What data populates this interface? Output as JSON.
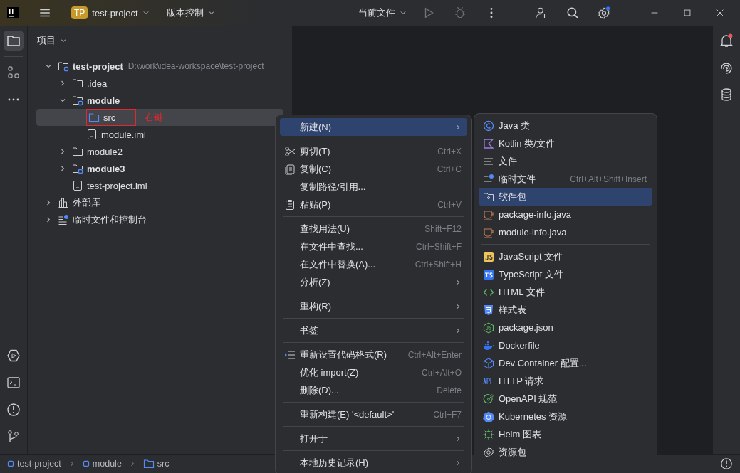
{
  "title_bar": {
    "project_badge": "TP",
    "project": "test-project",
    "vcs": "版本控制",
    "run_config": "当前文件"
  },
  "project_panel": {
    "title": "项目",
    "tree": [
      {
        "label": "test-project",
        "path": "D:\\work\\idea-workspace\\test-project",
        "kind": "module",
        "bold": true,
        "expanded": true,
        "selected": false,
        "children": [
          {
            "label": ".idea",
            "kind": "folder",
            "bold": false,
            "expanded": false,
            "selected": false
          },
          {
            "label": "module",
            "kind": "module",
            "bold": true,
            "expanded": true,
            "selected": false,
            "children": [
              {
                "label": "src",
                "kind": "source",
                "bold": false,
                "selected": true
              },
              {
                "label": "module.iml",
                "kind": "file",
                "bold": false,
                "selected": false
              }
            ]
          },
          {
            "label": "module2",
            "kind": "folder",
            "bold": false,
            "expanded": false,
            "selected": false
          },
          {
            "label": "module3",
            "kind": "module",
            "bold": true,
            "expanded": false,
            "selected": false
          },
          {
            "label": "test-project.iml",
            "kind": "file",
            "bold": false,
            "selected": false
          }
        ]
      },
      {
        "label": "外部库",
        "kind": "library",
        "bold": false,
        "expanded": false,
        "selected": false
      },
      {
        "label": "临时文件和控制台",
        "kind": "scratch",
        "bold": false,
        "expanded": false,
        "selected": false
      }
    ]
  },
  "annotation": {
    "label": "右键"
  },
  "context_menu": [
    {
      "kind": "item",
      "label": "新建(N)",
      "submenu": true,
      "selected": true
    },
    {
      "kind": "separator"
    },
    {
      "kind": "item",
      "label": "剪切(T)",
      "shortcut": "Ctrl+X",
      "submenu": false,
      "selected": false
    },
    {
      "kind": "item",
      "label": "复制(C)",
      "shortcut": "Ctrl+C",
      "submenu": false,
      "selected": false
    },
    {
      "kind": "item",
      "label": "复制路径/引用...",
      "submenu": false,
      "selected": false
    },
    {
      "kind": "item",
      "label": "粘贴(P)",
      "shortcut": "Ctrl+V",
      "submenu": false,
      "selected": false
    },
    {
      "kind": "separator"
    },
    {
      "kind": "item",
      "label": "查找用法(U)",
      "shortcut": "Shift+F12",
      "submenu": false,
      "selected": false
    },
    {
      "kind": "item",
      "label": "在文件中查找...",
      "shortcut": "Ctrl+Shift+F",
      "submenu": false,
      "selected": false
    },
    {
      "kind": "item",
      "label": "在文件中替换(A)...",
      "shortcut": "Ctrl+Shift+H",
      "submenu": false,
      "selected": false
    },
    {
      "kind": "item",
      "label": "分析(Z)",
      "submenu": true,
      "selected": false
    },
    {
      "kind": "separator"
    },
    {
      "kind": "item",
      "label": "重构(R)",
      "submenu": true,
      "selected": false
    },
    {
      "kind": "separator"
    },
    {
      "kind": "item",
      "label": "书签",
      "submenu": true,
      "selected": false
    },
    {
      "kind": "separator"
    },
    {
      "kind": "item",
      "label": "重新设置代码格式(R)",
      "shortcut": "Ctrl+Alt+Enter",
      "submenu": false,
      "selected": false
    },
    {
      "kind": "item",
      "label": "优化 import(Z)",
      "shortcut": "Ctrl+Alt+O",
      "submenu": false,
      "selected": false
    },
    {
      "kind": "item",
      "label": "删除(D)...",
      "shortcut": "Delete",
      "submenu": false,
      "selected": false
    },
    {
      "kind": "separator"
    },
    {
      "kind": "item",
      "label": "重新构建(E) '<default>'",
      "shortcut": "Ctrl+F7",
      "submenu": false,
      "selected": false
    },
    {
      "kind": "separator"
    },
    {
      "kind": "item",
      "label": "打开于",
      "submenu": true,
      "selected": false
    },
    {
      "kind": "separator"
    },
    {
      "kind": "item",
      "label": "本地历史记录(H)",
      "submenu": true,
      "selected": false
    }
  ],
  "new_submenu": [
    {
      "kind": "item",
      "label": "Java 类",
      "selected": false
    },
    {
      "kind": "item",
      "label": "Kotlin 类/文件",
      "selected": false
    },
    {
      "kind": "item",
      "label": "文件",
      "selected": false
    },
    {
      "kind": "item",
      "label": "临时文件",
      "shortcut": "Ctrl+Alt+Shift+Insert",
      "selected": false
    },
    {
      "kind": "item",
      "label": "软件包",
      "selected": true
    },
    {
      "kind": "item",
      "label": "package-info.java",
      "selected": false
    },
    {
      "kind": "item",
      "label": "module-info.java",
      "selected": false
    },
    {
      "kind": "separator"
    },
    {
      "kind": "item",
      "label": "JavaScript 文件",
      "selected": false
    },
    {
      "kind": "item",
      "label": "TypeScript 文件",
      "selected": false
    },
    {
      "kind": "item",
      "label": "HTML 文件",
      "selected": false
    },
    {
      "kind": "item",
      "label": "样式表",
      "selected": false
    },
    {
      "kind": "item",
      "label": "package.json",
      "selected": false
    },
    {
      "kind": "item",
      "label": "Dockerfile",
      "selected": false
    },
    {
      "kind": "item",
      "label": "Dev Container 配置...",
      "selected": false
    },
    {
      "kind": "item",
      "label": "HTTP 请求",
      "selected": false
    },
    {
      "kind": "item",
      "label": "OpenAPI 规范",
      "selected": false
    },
    {
      "kind": "item",
      "label": "Kubernetes 资源",
      "selected": false
    },
    {
      "kind": "item",
      "label": "Helm 图表",
      "selected": false
    },
    {
      "kind": "item",
      "label": "资源包",
      "selected": false
    }
  ],
  "status_bar": {
    "breadcrumbs": [
      {
        "label": "test-project",
        "kind": "module"
      },
      {
        "label": "module",
        "kind": "module"
      },
      {
        "label": "src",
        "kind": "source"
      }
    ]
  }
}
